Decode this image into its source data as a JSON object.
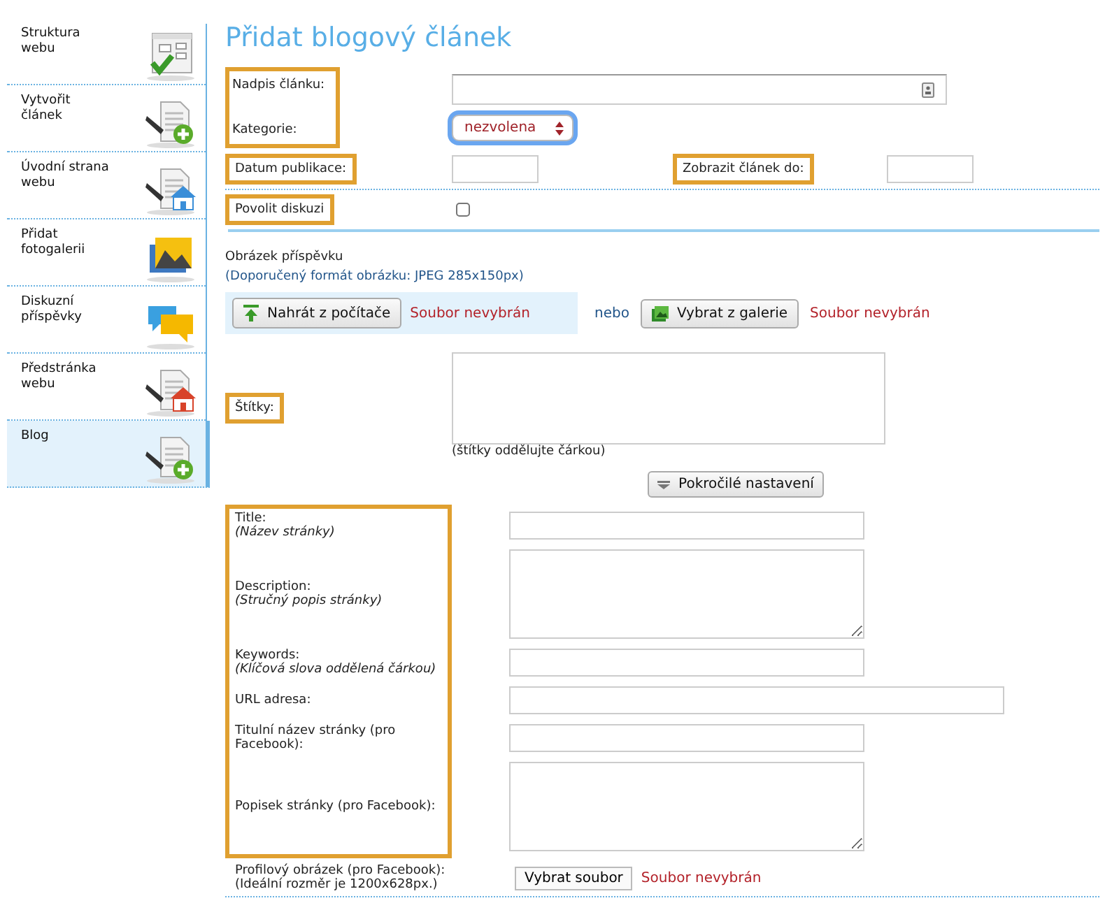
{
  "sidebar": {
    "items": [
      {
        "label": "Struktura webu",
        "kind": "structure",
        "selected": false
      },
      {
        "label": "Vytvořit článek",
        "kind": "new-document",
        "selected": false
      },
      {
        "label": "Úvodní strana webu",
        "kind": "home-blue",
        "selected": false
      },
      {
        "label": "Přidat fotogalerii",
        "kind": "gallery",
        "selected": false
      },
      {
        "label": "Diskuzní příspěvky",
        "kind": "chat",
        "selected": false
      },
      {
        "label": "Předstránka webu",
        "kind": "home-red",
        "selected": false
      },
      {
        "label": "Blog",
        "kind": "new-document",
        "selected": true
      }
    ]
  },
  "title": "Přidat blogový článek",
  "headline_group": {
    "highlighted": true,
    "headline_label": "Nadpis článku:",
    "category_label": "Kategorie:",
    "category_value": "nezvolena",
    "category_focused": true
  },
  "dates": {
    "publish_label": "Datum publikace:",
    "publish_highlighted": true,
    "until_label": "Zobrazit článek do:",
    "until_highlighted": true
  },
  "discussion": {
    "label": "Povolit diskuzi",
    "highlighted": true,
    "checked": false
  },
  "image": {
    "heading": "Obrázek příspěvku",
    "hint": "(Doporučený formát obrázku: JPEG 285x150px)",
    "upload_button": "Nahrát z počítače",
    "upload_status": "Soubor nevybrán",
    "or": "nebo",
    "gallery_button": "Vybrat z galerie",
    "gallery_status": "Soubor nevybrán"
  },
  "tags": {
    "label": "Štítky:",
    "highlighted": true,
    "hint": "(štítky oddělujte čárkou)"
  },
  "advanced_button": "Pokročilé nastavení",
  "seo": {
    "highlighted": true,
    "fields": [
      {
        "label": "Title:",
        "note": "(Název stránky)",
        "kind": "input"
      },
      {
        "label": "Description:",
        "note": "(Stručný popis stránky)",
        "kind": "textarea"
      },
      {
        "label": "Keywords:",
        "note": "(Klíčová slova oddělená čárkou)",
        "kind": "input"
      },
      {
        "label": "URL adresa:",
        "kind": "wide-input"
      },
      {
        "label": "Titulní název stránky (pro Facebook):",
        "kind": "input"
      },
      {
        "label": "Popisek stránky (pro Facebook):",
        "kind": "textarea"
      }
    ]
  },
  "profile_image": {
    "label": "Profilový obrázek (pro Facebook):",
    "hint": "(Ideální rozměr je 1200x628px.)",
    "button": "Vybrat soubor",
    "status": "Soubor nevybrán"
  }
}
